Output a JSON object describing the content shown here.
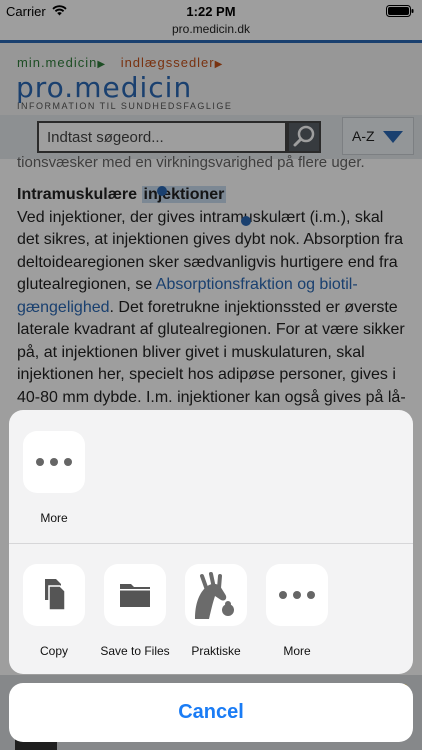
{
  "status_bar": {
    "carrier": "Carrier",
    "time": "1:22 PM"
  },
  "browser": {
    "url": "pro.medicin.dk"
  },
  "site": {
    "link_min": "min.medicin",
    "link_ind": "indlægssedler",
    "brand": "pro.medicin",
    "tagline": "INFORMATION TIL SUNDHEDSFAGLIGE",
    "search_placeholder": "Indtast søgeord...",
    "az_label": "A-Z"
  },
  "article": {
    "cut_line": "tionsvæsker med en virkningsvarighed på flere uger.",
    "heading_part1": "Intramuskulære",
    "heading_selected": "injektioner",
    "text1": "Ved injektioner, der gives intramuskulært (i.m.), skal det sikres, at injektionen gives dybt nok. Absorption fra deltoidearegionen sker sædvanligvis hurtigere end fra glutealregionen, se ",
    "link": "Absorptionsfraktion og biotil-gængelighed",
    "text2": ". Det foretrukne injektionssted er øverste laterale kvadrant af glutealregionen. For at være sikker på, at injektionen bliver givet i muskulaturen, skal injektionen her, specielt hos adipøse personer, gives i 40-80 mm dybde. I.m. injektioner kan også gives på lå-"
  },
  "share_sheet": {
    "top_row": [
      {
        "label": "More",
        "icon": "more-icon"
      }
    ],
    "actions": [
      {
        "label": "Copy",
        "icon": "copy-icon"
      },
      {
        "label": "Save to Files",
        "icon": "folder-icon"
      },
      {
        "label": "Praktiske",
        "icon": "praktiske-app-icon"
      },
      {
        "label": "More",
        "icon": "more-icon"
      }
    ],
    "cancel_label": "Cancel"
  },
  "colors": {
    "accent": "#1a7cf5",
    "brand_blue": "#2a68b4",
    "brand_green": "#2f7d3a",
    "brand_orange": "#c4521b"
  }
}
